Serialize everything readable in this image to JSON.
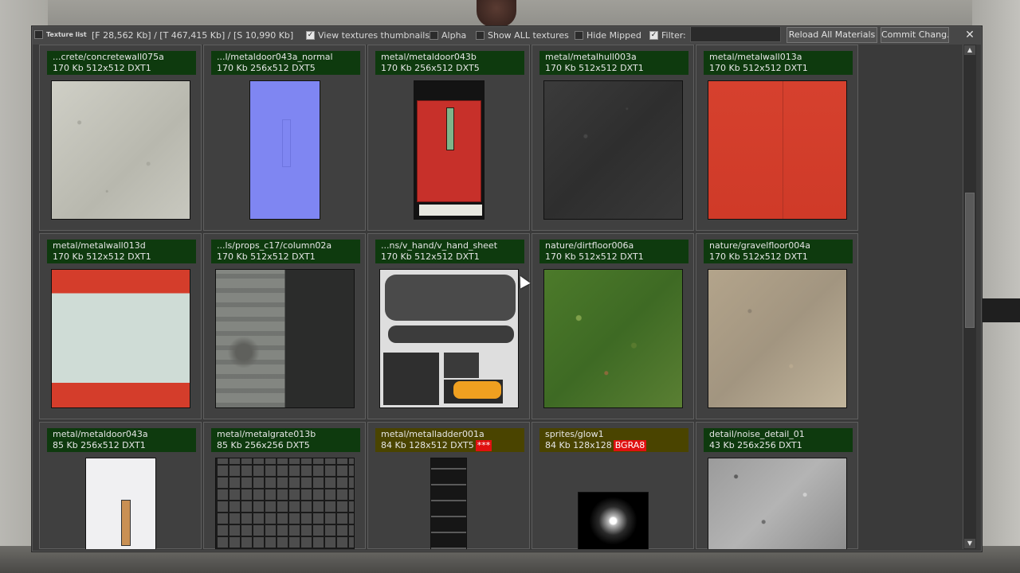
{
  "toolbar": {
    "title": "Texture list",
    "stats": "[F 28,562 Kb] / [T 467,415 Kb] / [S 10,990 Kb]",
    "view_thumbnails": {
      "label": "View textures thumbnails",
      "checked": true
    },
    "alpha": {
      "label": "Alpha",
      "checked": false
    },
    "show_all": {
      "label": "Show ALL textures",
      "checked": false
    },
    "hide_mipped": {
      "label": "Hide Mipped",
      "checked": false
    },
    "filter": {
      "label": "Filter:",
      "checked": true,
      "value": ""
    },
    "reload_button": "Reload All Materials",
    "commit_button": "Commit Chang."
  },
  "textures": [
    {
      "name": "...crete/concretewall075a",
      "info": "170 Kb  512x512  DXT1",
      "texture": "concrete"
    },
    {
      "name": "...l/metaldoor043a_normal",
      "info": "170 Kb  256x512  DXT5",
      "texture": "normal"
    },
    {
      "name": "metal/metaldoor043b",
      "info": "170 Kb  256x512  DXT5",
      "texture": "door-red"
    },
    {
      "name": "metal/metalhull003a",
      "info": "170 Kb  512x512  DXT1",
      "texture": "metalhull"
    },
    {
      "name": "metal/metalwall013a",
      "info": "170 Kb  512x512  DXT1",
      "texture": "redwall"
    },
    {
      "name": "metal/metalwall013d",
      "info": "170 Kb  512x512  DXT1",
      "texture": "stripe"
    },
    {
      "name": "...ls/props_c17/column02a",
      "info": "170 Kb  512x512  DXT1",
      "texture": "column"
    },
    {
      "name": "...ns/v_hand/v_hand_sheet",
      "info": "170 Kb  512x512  DXT1",
      "texture": "hand"
    },
    {
      "name": "nature/dirtfloor006a",
      "info": "170 Kb  512x512  DXT1",
      "texture": "dirt"
    },
    {
      "name": "nature/gravelfloor004a",
      "info": "170 Kb  512x512  DXT1",
      "texture": "gravel"
    },
    {
      "name": "metal/metaldoor043a",
      "info": "85 Kb  256x512  DXT1",
      "texture": "door-white"
    },
    {
      "name": "metal/metalgrate013b",
      "info": "85 Kb  256x256  DXT5",
      "texture": "grate"
    },
    {
      "name": "metal/metalladder001a",
      "info": "84 Kb  128x512  DXT5",
      "badge": "***",
      "warn": true,
      "texture": "ladder"
    },
    {
      "name": "sprites/glow1",
      "info": "84 Kb  128x128",
      "badge": "BGRA8",
      "warn": true,
      "texture": "glow"
    },
    {
      "name": "detail/noise_detail_01",
      "info": "43 Kb  256x256  DXT1",
      "texture": "noise"
    }
  ],
  "colors": {
    "label_bg": "#0e3a0e",
    "label_warn_bg": "#4a4400",
    "badge_bg": "#e01010"
  },
  "icons": {
    "close": "close-icon",
    "scroll_up": "arrow-up-icon",
    "scroll_down": "arrow-down-icon"
  }
}
